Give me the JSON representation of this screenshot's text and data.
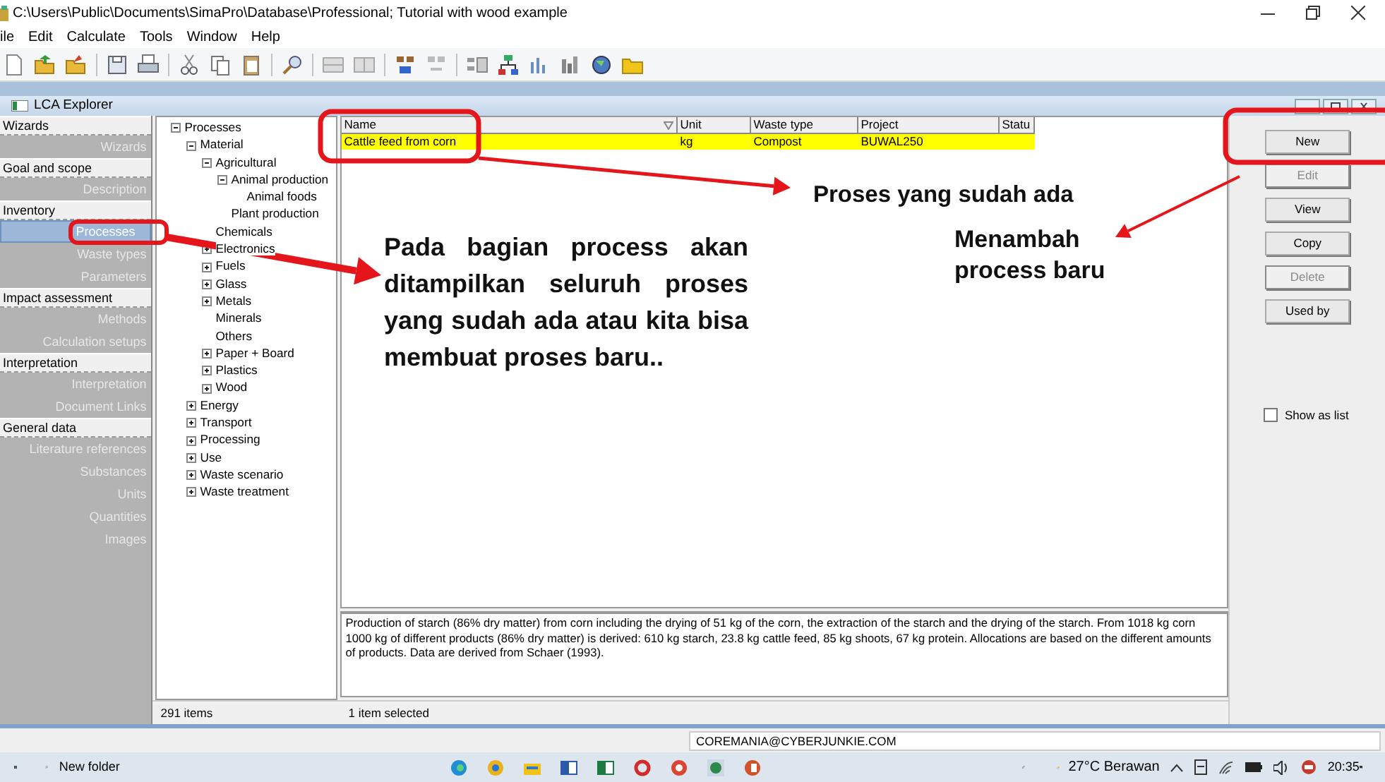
{
  "window": {
    "title": "C:\\Users\\Public\\Documents\\SimaPro\\Database\\Professional; Tutorial with wood example"
  },
  "menu": [
    "ile",
    "Edit",
    "Calculate",
    "Tools",
    "Window",
    "Help"
  ],
  "explorer": {
    "title": "LCA Explorer",
    "nav": [
      {
        "title": "Wizards",
        "items": [
          {
            "label": "Wizards",
            "selected": false
          }
        ]
      },
      {
        "title": "Goal and scope",
        "items": [
          {
            "label": "Description",
            "selected": false
          }
        ]
      },
      {
        "title": "Inventory",
        "items": [
          {
            "label": "Processes",
            "selected": true
          },
          {
            "label": "Waste types",
            "selected": false
          },
          {
            "label": "Parameters",
            "selected": false
          }
        ]
      },
      {
        "title": "Impact assessment",
        "items": [
          {
            "label": "Methods",
            "selected": false
          },
          {
            "label": "Calculation setups",
            "selected": false
          }
        ]
      },
      {
        "title": "Interpretation",
        "items": [
          {
            "label": "Interpretation",
            "selected": false
          },
          {
            "label": "Document Links",
            "selected": false
          }
        ]
      },
      {
        "title": "General data",
        "items": [
          {
            "label": "Literature references",
            "selected": false
          },
          {
            "label": "Substances",
            "selected": false
          },
          {
            "label": "Units",
            "selected": false
          },
          {
            "label": "Quantities",
            "selected": false
          },
          {
            "label": "Images",
            "selected": false
          }
        ]
      }
    ],
    "tree": [
      {
        "label": "Processes",
        "expanded": true,
        "children": [
          {
            "label": "Material",
            "expanded": true,
            "children": [
              {
                "label": "Agricultural",
                "expanded": true,
                "children": [
                  {
                    "label": "Animal production",
                    "expanded": true,
                    "children": [
                      {
                        "label": "Animal foods"
                      }
                    ]
                  },
                  {
                    "label": "Plant production"
                  }
                ]
              },
              {
                "label": "Chemicals"
              },
              {
                "label": "Electronics",
                "expanded": false
              },
              {
                "label": "Fuels",
                "expanded": false
              },
              {
                "label": "Glass",
                "expanded": false
              },
              {
                "label": "Metals",
                "expanded": false
              },
              {
                "label": "Minerals"
              },
              {
                "label": "Others"
              },
              {
                "label": "Paper + Board",
                "expanded": false
              },
              {
                "label": "Plastics",
                "expanded": false
              },
              {
                "label": "Wood",
                "expanded": false
              }
            ]
          },
          {
            "label": "Energy",
            "expanded": false
          },
          {
            "label": "Transport",
            "expanded": false
          },
          {
            "label": "Processing",
            "expanded": false
          },
          {
            "label": "Use",
            "expanded": false
          },
          {
            "label": "Waste scenario",
            "expanded": false
          },
          {
            "label": "Waste treatment",
            "expanded": false
          }
        ]
      }
    ],
    "tree_status": "291 items",
    "table": {
      "columns": [
        "Name",
        "Unit",
        "Waste type",
        "Project",
        "Statu"
      ],
      "rows": [
        {
          "cells": [
            "Cattle feed from corn",
            "kg",
            "Compost",
            "BUWAL250"
          ],
          "selected": true
        }
      ]
    },
    "description": "Production of starch (86% dry matter) from corn including the drying of 51 kg of the corn, the extraction of the starch and the drying of the starch. From 1018 kg corn 1000 kg of different products (86% dry matter) is derived: 610 kg starch, 23.8 kg cattle feed, 85 kg shoots, 67 kg protein. Allocations are based on the different amounts of products. Data are derived from Schaer (1993).",
    "list_status": "1 item selected",
    "buttons": [
      {
        "label": "New",
        "disabled": false
      },
      {
        "label": "Edit",
        "disabled": true
      },
      {
        "label": "View",
        "disabled": false
      },
      {
        "label": "Copy",
        "disabled": false
      },
      {
        "label": "Delete",
        "disabled": true
      },
      {
        "label": "Used by",
        "disabled": false
      }
    ],
    "show_as_list": {
      "label": "Show as list",
      "checked": false
    }
  },
  "annotations": {
    "existing_note": "Proses yang sudah ada",
    "process_note": "Pada bagian process akan ditampilkan seluruh proses yang sudah ada atau kita bisa membuat proses baru..",
    "new_note": "Menambah process baru"
  },
  "footer": {
    "text": "COREMANIA@CYBERJUNKIE.COM"
  },
  "taskbar": {
    "search": "New folder",
    "weather": "27°C Berawan",
    "time": "20:35"
  }
}
